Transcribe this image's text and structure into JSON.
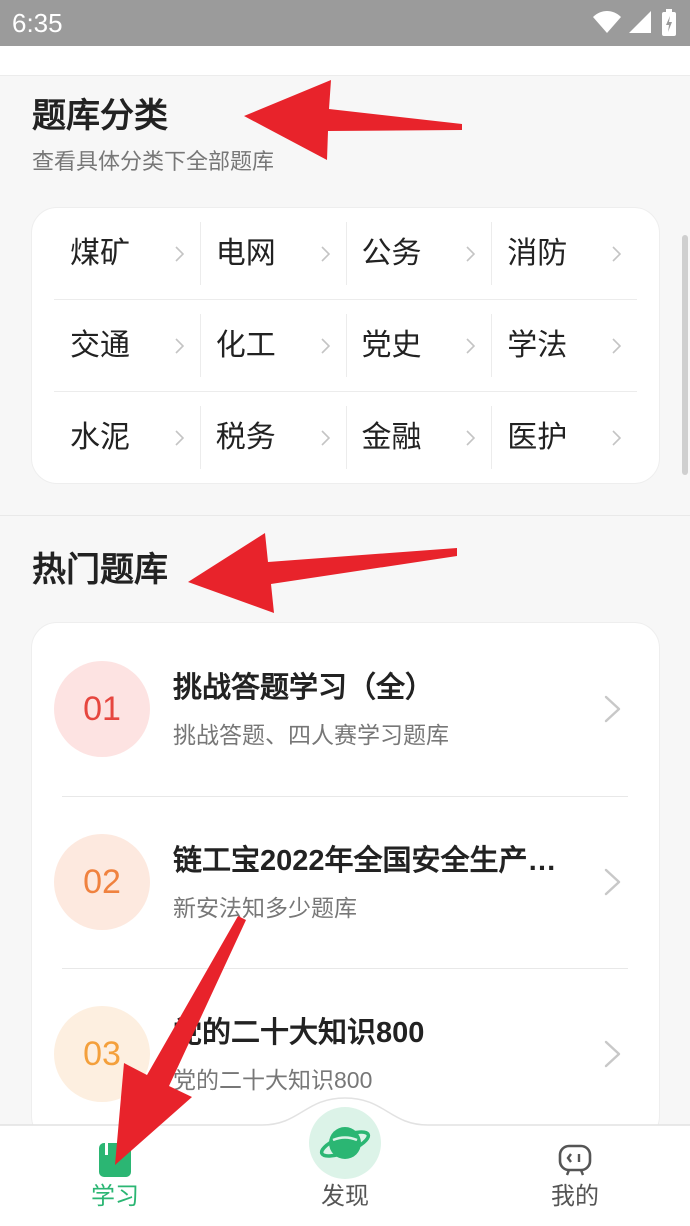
{
  "status_bar": {
    "time": "6:35",
    "icons": [
      "wifi-icon",
      "signal-icon",
      "battery-icon"
    ]
  },
  "category_section": {
    "title": "题库分类",
    "subtitle": "查看具体分类下全部题库",
    "items": [
      {
        "label": "煤矿"
      },
      {
        "label": "电网"
      },
      {
        "label": "公务"
      },
      {
        "label": "消防"
      },
      {
        "label": "交通"
      },
      {
        "label": "化工"
      },
      {
        "label": "党史"
      },
      {
        "label": "学法"
      },
      {
        "label": "水泥"
      },
      {
        "label": "税务"
      },
      {
        "label": "金融"
      },
      {
        "label": "医护"
      }
    ]
  },
  "hot_section": {
    "title": "热门题库",
    "items": [
      {
        "rank": "01",
        "title": "挑战答题学习（全）",
        "subtitle": "挑战答题、四人赛学习题库",
        "rank_bg": "#fde3e2",
        "rank_color": "#e6463f"
      },
      {
        "rank": "02",
        "title": "链工宝2022年全国安全生产…",
        "subtitle": "新安法知多少题库",
        "rank_bg": "#fde9df",
        "rank_color": "#f0823f"
      },
      {
        "rank": "03",
        "title": "党的二十大知识800",
        "subtitle": "党的二十大知识800",
        "rank_bg": "#fdefe0",
        "rank_color": "#f4a03c"
      }
    ]
  },
  "bottom_nav": {
    "items": [
      {
        "label": "学习",
        "icon": "book-icon",
        "active": true
      },
      {
        "label": "发现",
        "icon": "planet-icon",
        "active": false
      },
      {
        "label": "我的",
        "icon": "robot-face-icon",
        "active": false
      }
    ]
  },
  "colors": {
    "accent": "#2bb673",
    "status_bar": "#9b9b9b",
    "annotation_arrow": "#e8232b"
  }
}
